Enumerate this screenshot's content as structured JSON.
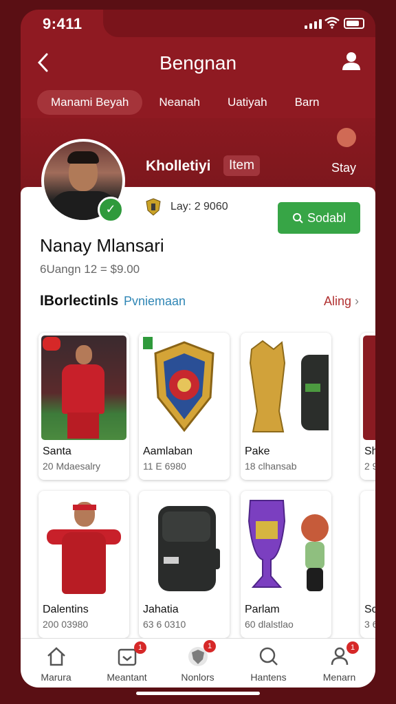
{
  "status": {
    "time": "9:411"
  },
  "header": {
    "title": "Bengnan"
  },
  "tabs": [
    {
      "label": "Manami Beyah",
      "active": true
    },
    {
      "label": "Neanah",
      "active": false
    },
    {
      "label": "Uatiyah",
      "active": false
    },
    {
      "label": "Barn",
      "active": false
    }
  ],
  "profile": {
    "section_title": "Kholletiyi",
    "item_pill": "Item",
    "stay": "Stay",
    "lay": "Lay: 2 9060",
    "action_button": "Sodabl",
    "name": "Nanay Mlansari",
    "sub": "6Uangn 12 = $9.00"
  },
  "collections": {
    "title": "IBorlectinls",
    "subtitle": "Pvniemaan",
    "link": "Aling"
  },
  "items": [
    {
      "name": "Santa",
      "sub": "20 Mdaesalry",
      "icon": "player-photo"
    },
    {
      "name": "Aamlaban",
      "sub": "11 E 6980",
      "icon": "shield-crest"
    },
    {
      "name": "Pake",
      "sub": "18 clhansab",
      "icon": "golden-trophy-bag"
    },
    {
      "name": "Sh",
      "sub": "2 9",
      "icon": "partial"
    },
    {
      "name": "Dalentins",
      "sub": "200 03980",
      "icon": "player-figure"
    },
    {
      "name": "Jahatia",
      "sub": "63 6 0310",
      "icon": "backpack"
    },
    {
      "name": "Parlam",
      "sub": "60 dlalstlao",
      "icon": "purple-trophy-mascot"
    },
    {
      "name": "Sc",
      "sub": "3 6",
      "icon": "partial"
    }
  ],
  "nav": [
    {
      "label": "Marura",
      "icon": "home-icon",
      "badge": ""
    },
    {
      "label": "Meantant",
      "icon": "inbox-icon",
      "badge": "1"
    },
    {
      "label": "Nonlors",
      "icon": "shield-nav-icon",
      "badge": "1"
    },
    {
      "label": "Hantens",
      "icon": "search-chat-icon",
      "badge": ""
    },
    {
      "label": "Menarn",
      "icon": "profile-icon",
      "badge": "1"
    }
  ],
  "colors": {
    "brand": "#8f1a22",
    "accent": "#37a546",
    "link": "#2f86b5"
  }
}
